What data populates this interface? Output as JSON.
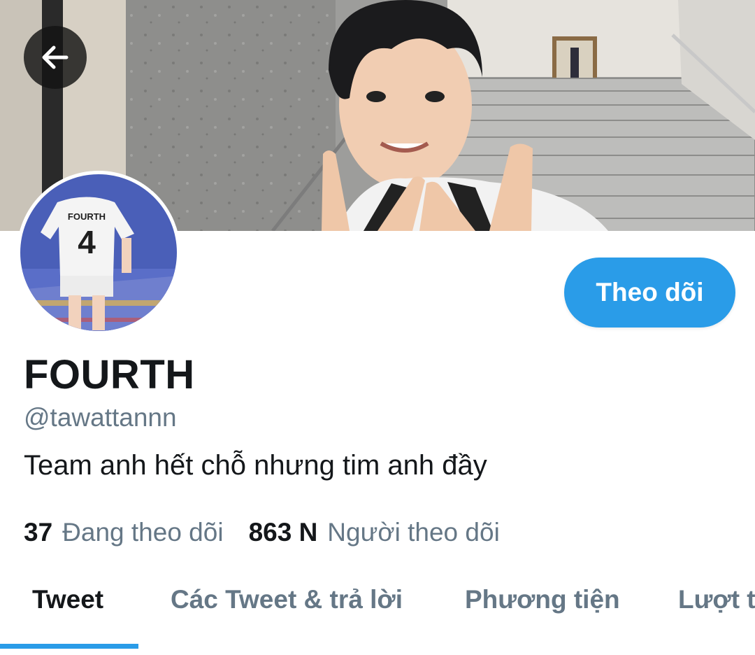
{
  "profile": {
    "display_name": "FOURTH",
    "handle": "@tawattannn",
    "bio": "Team anh hết chỗ nhưng tim anh đầy",
    "avatar_jersey_name": "FOURTH",
    "avatar_jersey_number": "4"
  },
  "header": {
    "back_icon": "arrow-left-icon"
  },
  "actions": {
    "follow_label": "Theo dõi"
  },
  "stats": {
    "following_count": "37",
    "following_label": "Đang theo dõi",
    "followers_count": "863 N",
    "followers_label": "Người theo dõi"
  },
  "tabs": [
    {
      "label": "Tweet",
      "active": true
    },
    {
      "label": "Các Tweet & trả lời",
      "active": false
    },
    {
      "label": "Phương tiện",
      "active": false
    },
    {
      "label": "Lượt thích",
      "active": false
    }
  ],
  "colors": {
    "accent": "#2a9ce8",
    "secondary_text": "#657786",
    "primary_text": "#14171a"
  }
}
